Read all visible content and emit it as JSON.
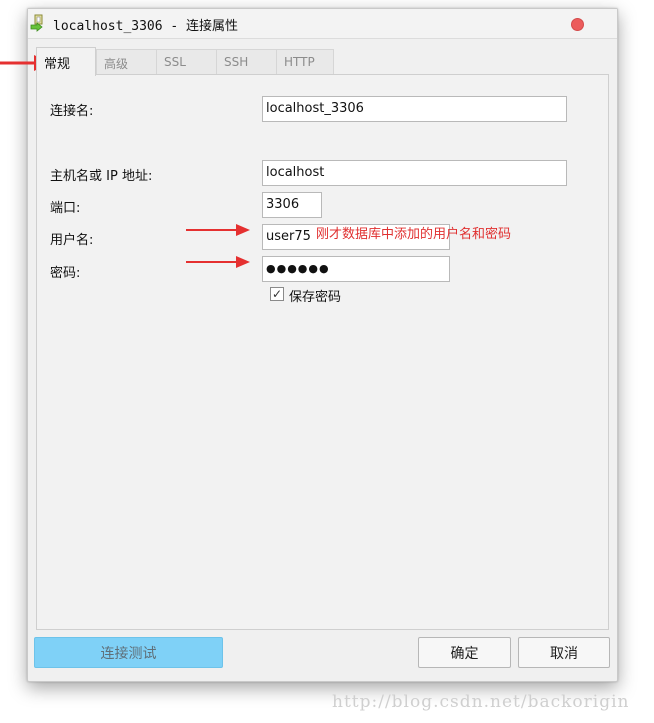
{
  "window": {
    "title": "localhost_3306 - 连接属性"
  },
  "tabs": [
    {
      "label": "常规"
    },
    {
      "label": "高级"
    },
    {
      "label": "SSL"
    },
    {
      "label": "SSH"
    },
    {
      "label": "HTTP"
    }
  ],
  "form": {
    "connection_name_label": "连接名:",
    "connection_name_value": "localhost_3306",
    "host_label": "主机名或 IP 地址:",
    "host_value": "localhost",
    "port_label": "端口:",
    "port_value": "3306",
    "username_label": "用户名:",
    "username_value": "user75",
    "password_label": "密码:",
    "password_value": "●●●●●●",
    "save_password_label": "保存密码",
    "save_password_checked": true
  },
  "annotation": {
    "text": "刚才数据库中添加的用户名和密码",
    "color": "#e03030"
  },
  "buttons": {
    "test_label": "连接测试",
    "ok_label": "确定",
    "cancel_label": "取消"
  },
  "watermark": "http://blog.csdn.net/backorigin",
  "colors": {
    "accent": "#7fd1f7",
    "close": "#ec5c5c",
    "annotation": "#e03030"
  }
}
